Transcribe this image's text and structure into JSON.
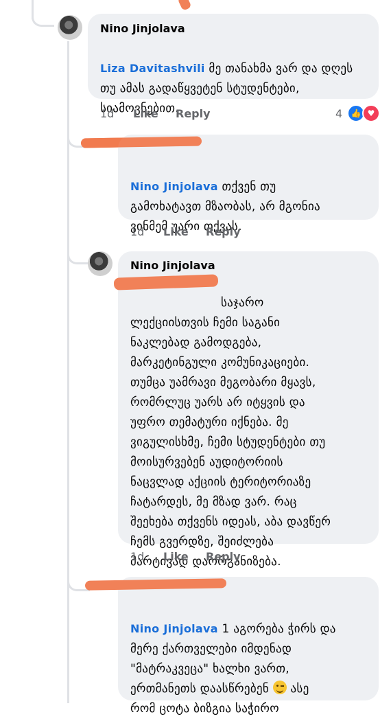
{
  "comments": [
    {
      "author": "Nino Jinjolava",
      "mention": "Liza Davitashvili",
      "lines": [
        " მე თანახმა ვარ და დღეს",
        "თუ ამას გადაწყვეტენ სტუდენტები,",
        "სიამოვნებით."
      ],
      "time": "1d",
      "like": "Like",
      "reply": "Reply",
      "reactions": "4"
    },
    {
      "author": "",
      "mention": "Nino Jinjolava",
      "lines": [
        " თქვენ თუ",
        "გამოხატავთ მზაობას, არ მგონია",
        "ვინმემ უარი თქვას."
      ],
      "time": "1d",
      "like": "Like",
      "reply": "Reply"
    },
    {
      "author": "Nino Jinjolava",
      "mention": "",
      "lines": [
        "საჯარო",
        "ლექციისთვის ჩემი საგანი",
        "ნაკლებად გამოდგება,",
        "მარკეტინგული კომუნიკაციები.",
        "თუმცა უამრავი მეგობარი მყავს,",
        "რომრლუც უარს არ იტყვის და",
        "უფრო თემატური იქნება. მე",
        "ვიგულისხმე, ჩემი სტუდენტები თუ",
        "მოისურვებენ აუდიტორიის",
        "ნაცვლად აქციის ტერიტორიაზე",
        "ჩატარდეს, მე მზად ვარ. რაც",
        "შეეხება თქვენს იდეას, აბა დავწერ",
        "ჩემს გვერდზე, შეიძლება",
        "მარტივად დაორგანიზება."
      ],
      "time": "1d",
      "like": "Like",
      "reply": "Reply"
    },
    {
      "author": "",
      "mention": "Nino Jinjolava",
      "lines": [
        " 1 აგორება ჭირს და",
        "მერე ქართველები იმდენად",
        "\"მატრაკვეცა\" ხალხი ვართ,",
        "ერთმანეთს დაასწრებენ",
        "რომ ცოტა ბიზგია საჭირო"
      ],
      "line4_suffix": " ასე",
      "time": "",
      "like": "",
      "reply": ""
    }
  ],
  "icons": {
    "like": "like-icon",
    "love": "love-icon",
    "wink": "wink-emoji-icon"
  },
  "colors": {
    "bubble": "#eef0f3",
    "mention": "#1a6ed8",
    "redaction": "#f07a4f",
    "like_blue": "#1877f2",
    "love_red": "#f33e58"
  }
}
